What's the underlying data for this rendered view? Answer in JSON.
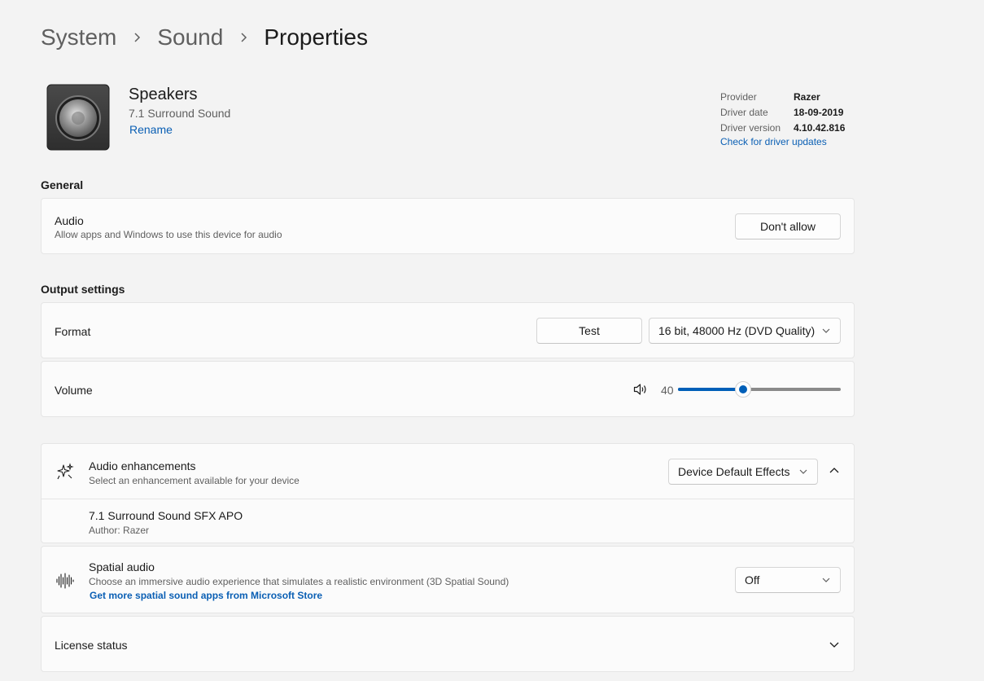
{
  "breadcrumb": [
    "System",
    "Sound",
    "Properties"
  ],
  "device": {
    "name": "Speakers",
    "subtitle": "7.1 Surround Sound",
    "rename_label": "Rename",
    "icon": "speaker-icon"
  },
  "driver": {
    "rows": [
      {
        "label": "Provider",
        "value": "Razer"
      },
      {
        "label": "Driver date",
        "value": "18-09-2019"
      },
      {
        "label": "Driver version",
        "value": "4.10.42.816"
      }
    ],
    "update_link": "Check for driver updates"
  },
  "general": {
    "title": "General",
    "audio": {
      "title": "Audio",
      "description": "Allow apps and Windows to use this device for audio",
      "button": "Don't allow"
    }
  },
  "output": {
    "title": "Output settings",
    "format": {
      "title": "Format",
      "test_button": "Test",
      "selected": "16 bit, 48000 Hz (DVD Quality)"
    },
    "volume": {
      "title": "Volume",
      "value": "40",
      "level_percent": 40
    }
  },
  "enhancements": {
    "title": "Audio enhancements",
    "description": "Select an enhancement available for your device",
    "selected": "Device Default Effects",
    "item": {
      "title": "7.1 Surround Sound SFX APO",
      "author": "Author: Razer"
    }
  },
  "spatial": {
    "title": "Spatial audio",
    "description": "Choose an immersive audio experience that simulates a realistic environment (3D Spatial Sound)",
    "link": "Get more spatial sound apps from Microsoft Store",
    "selected": "Off"
  },
  "license": {
    "title": "License status"
  },
  "colors": {
    "accent": "#005fb8",
    "link": "#0a5fb4",
    "background": "#f3f3f3",
    "card": "#fbfbfb"
  }
}
